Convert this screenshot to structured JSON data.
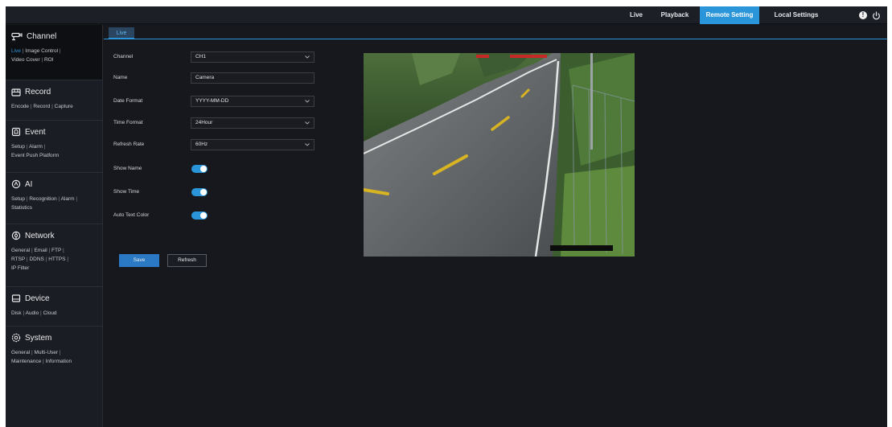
{
  "top_nav": {
    "tabs": [
      {
        "label": "Live"
      },
      {
        "label": "Playback"
      },
      {
        "label": "Remote Setting",
        "active": true
      },
      {
        "label": "Local Settings"
      }
    ],
    "info_icon": "info-icon",
    "power_icon": "power-icon"
  },
  "sidebar": {
    "sections": [
      {
        "title": "Channel",
        "icon": "camera-icon",
        "active": true,
        "links": [
          "Live",
          "Image Control",
          "Video Cover",
          "ROI"
        ]
      },
      {
        "title": "Record",
        "icon": "record-icon",
        "links": [
          "Encode",
          "Record",
          "Capture"
        ]
      },
      {
        "title": "Event",
        "icon": "event-icon",
        "links": [
          "Setup",
          "Alarm",
          "Event Push Platform"
        ]
      },
      {
        "title": "AI",
        "icon": "ai-icon",
        "links": [
          "Setup",
          "Recognition",
          "Alarm",
          "Statistics"
        ]
      },
      {
        "title": "Network",
        "icon": "network-icon",
        "links": [
          "General",
          "Email",
          "FTP",
          "RTSP",
          "DDNS",
          "HTTPS",
          "IP Filter"
        ]
      },
      {
        "title": "Device",
        "icon": "device-icon",
        "links": [
          "Disk",
          "Audio",
          "Cloud"
        ]
      },
      {
        "title": "System",
        "icon": "system-icon",
        "links": [
          "General",
          "Multi-User",
          "Maintenance",
          "Information"
        ]
      }
    ]
  },
  "main": {
    "subtab": "Live",
    "fields": {
      "channel": {
        "label": "Channel",
        "value": "CH1"
      },
      "name": {
        "label": "Name",
        "value": "Camera"
      },
      "date_format": {
        "label": "Date Format",
        "value": "YYYY-MM-DD"
      },
      "time_format": {
        "label": "Time Format",
        "value": "24Hour"
      },
      "refresh_rate": {
        "label": "Refresh Rate",
        "value": "60Hz"
      }
    },
    "toggles": {
      "show_name": {
        "label": "Show Name",
        "on": true
      },
      "show_time": {
        "label": "Show Time",
        "on": true
      },
      "auto_text_color": {
        "label": "Auto Text Color",
        "on": true
      }
    },
    "buttons": {
      "save": "Save",
      "refresh": "Refresh"
    }
  },
  "colors": {
    "accent": "#2b95d9",
    "background": "#16181e",
    "sidebar": "#1b1d24"
  }
}
